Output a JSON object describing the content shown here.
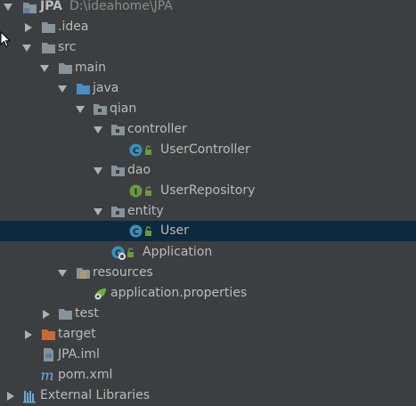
{
  "tree": {
    "root": {
      "label": "JPA",
      "path": "D:\\ideahome\\JPA",
      "icon": "module-folder-icon"
    },
    "idea": {
      "label": ".idea",
      "icon": "folder-icon"
    },
    "src": {
      "label": "src",
      "icon": "folder-icon"
    },
    "main": {
      "label": "main",
      "icon": "folder-icon"
    },
    "java": {
      "label": "java",
      "icon": "source-root-folder-icon"
    },
    "qian": {
      "label": "qian",
      "icon": "package-icon"
    },
    "controller": {
      "label": "controller",
      "icon": "package-icon"
    },
    "user_controller": {
      "label": "UserController",
      "icon": "java-class-icon",
      "badge": "C"
    },
    "dao": {
      "label": "dao",
      "icon": "package-icon"
    },
    "user_repository": {
      "label": "UserRepository",
      "icon": "java-interface-icon",
      "badge": "I"
    },
    "entity": {
      "label": "entity",
      "icon": "package-icon"
    },
    "user": {
      "label": "User",
      "icon": "java-class-icon",
      "badge": "C",
      "selected": true
    },
    "application": {
      "label": "Application",
      "icon": "spring-boot-class-icon",
      "badge": "C"
    },
    "resources": {
      "label": "resources",
      "icon": "resources-folder-icon"
    },
    "app_properties": {
      "label": "application.properties",
      "icon": "spring-properties-icon"
    },
    "test": {
      "label": "test",
      "icon": "folder-icon"
    },
    "target": {
      "label": "target",
      "icon": "excluded-folder-icon"
    },
    "jpa_iml": {
      "label": "JPA.iml",
      "icon": "iml-file-icon"
    },
    "pom": {
      "label": "pom.xml",
      "icon": "maven-file-icon",
      "badge": "m"
    },
    "external_libraries": {
      "label": "External Libraries",
      "icon": "libraries-icon"
    }
  },
  "colors": {
    "background": "#3c3f41",
    "selection": "#0d293e",
    "text": "#bbbbbb",
    "folder": "#87939a",
    "source_folder": "#4a8fbf",
    "class_badge": "#3d8fb7",
    "interface_badge": "#6a9a3e",
    "excluded_folder": "#c96a31"
  }
}
